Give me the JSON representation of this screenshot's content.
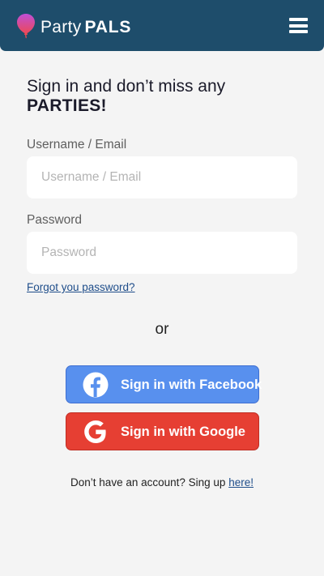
{
  "header": {
    "brand_light": "Party",
    "brand_bold": "PALS",
    "logo_icon": "balloon-icon",
    "menu_icon": "hamburger-menu-icon",
    "background_color": "#1e4d6b"
  },
  "headline": {
    "line1": "Sign in and don’t miss any",
    "line2": "PARTIES!"
  },
  "form": {
    "username": {
      "label": "Username / Email",
      "placeholder": "Username / Email",
      "value": ""
    },
    "password": {
      "label": "Password",
      "placeholder": "Password",
      "value": ""
    },
    "forgot_link": "Forgot you password?"
  },
  "divider": {
    "or_text": "or"
  },
  "social": {
    "facebook": {
      "label": "Sign in with Facebook",
      "icon": "facebook-icon",
      "color": "#5890ee"
    },
    "google": {
      "label": "Sign in with Google",
      "icon": "google-icon",
      "color": "#e63f33"
    }
  },
  "signup": {
    "prompt": "Don’t have an account? Sing up",
    "link": "here!"
  }
}
